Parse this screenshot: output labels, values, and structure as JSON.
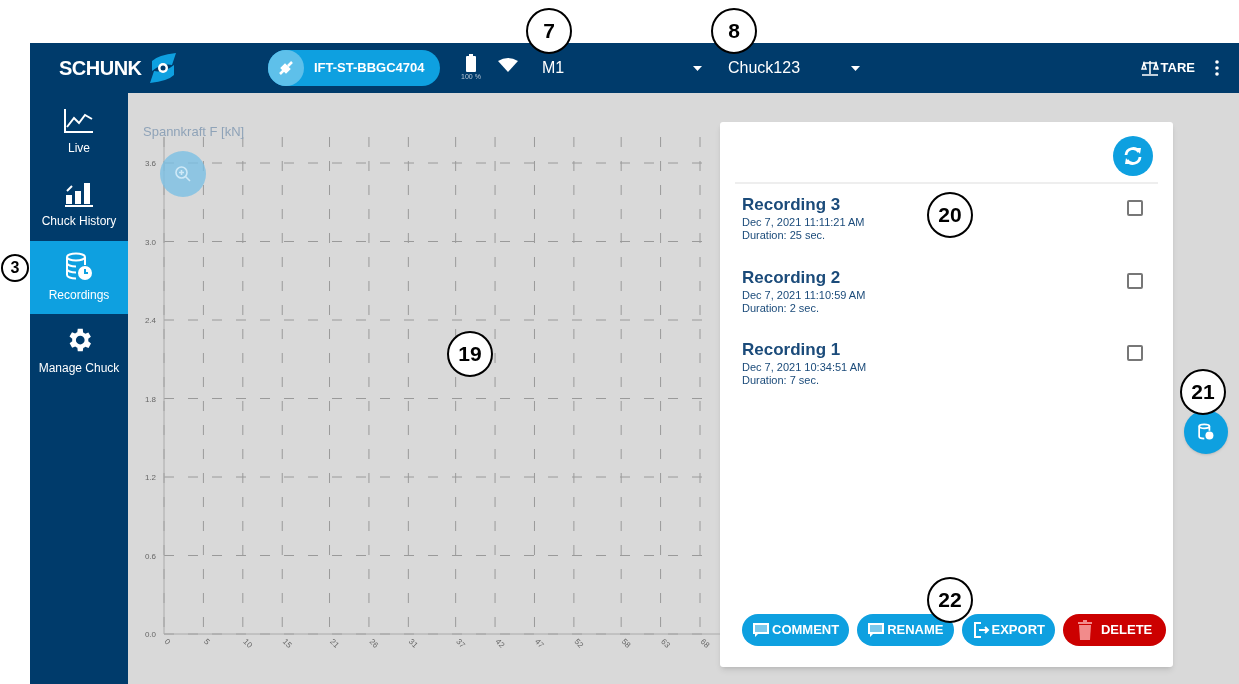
{
  "header": {
    "logo": "SCHUNK",
    "device": "IFT-ST-BBGC4704",
    "battery": "100 %",
    "machine": "M1",
    "chuck": "Chuck123",
    "tare": "TARE"
  },
  "sidebar": {
    "items": [
      {
        "label": "Live",
        "kind": "live",
        "selected": false
      },
      {
        "label": "Chuck History",
        "kind": "history",
        "selected": false
      },
      {
        "label": "Recordings",
        "kind": "recordings",
        "selected": true
      },
      {
        "label": "Manage Chuck",
        "kind": "manage",
        "selected": false
      }
    ]
  },
  "chart": {
    "chart_data": {
      "type": "line",
      "grid": true,
      "ylabel": "Spannkraft F [kN]",
      "xlim": [
        0,
        68
      ],
      "ylim": [
        0,
        3.6
      ],
      "yticks": [
        {
          "value": 0,
          "label": "0.0"
        },
        {
          "value": 0.6,
          "label": "0.6"
        },
        {
          "value": 1.2,
          "label": "1.2"
        },
        {
          "value": 1.8,
          "label": "1.8"
        },
        {
          "value": 2.4,
          "label": "2.4"
        },
        {
          "value": 3.0,
          "label": "3.0"
        },
        {
          "value": 3.6,
          "label": "3.6"
        }
      ],
      "xticks": [
        0,
        5,
        10,
        15,
        21,
        26,
        31,
        37,
        42,
        47,
        52,
        58,
        63,
        68
      ]
    }
  },
  "recordings": [
    {
      "title": "Recording 3",
      "date": "Dec 7, 2021 11:11:21 AM",
      "duration": "Duration: 25 sec.",
      "checked": false
    },
    {
      "title": "Recording 2",
      "date": "Dec 7, 2021 11:10:59 AM",
      "duration": "Duration: 2 sec.",
      "checked": false
    },
    {
      "title": "Recording 1",
      "date": "Dec 7, 2021 10:34:51 AM",
      "duration": "Duration: 7 sec.",
      "checked": false
    }
  ],
  "actions": [
    {
      "label": "COMMENT",
      "kind": "comment"
    },
    {
      "label": "RENAME",
      "kind": "rename"
    },
    {
      "label": "EXPORT",
      "kind": "export"
    },
    {
      "label": "DELETE",
      "kind": "delete"
    }
  ],
  "callouts": [
    "3",
    "7",
    "8",
    "19",
    "20",
    "21",
    "22"
  ]
}
